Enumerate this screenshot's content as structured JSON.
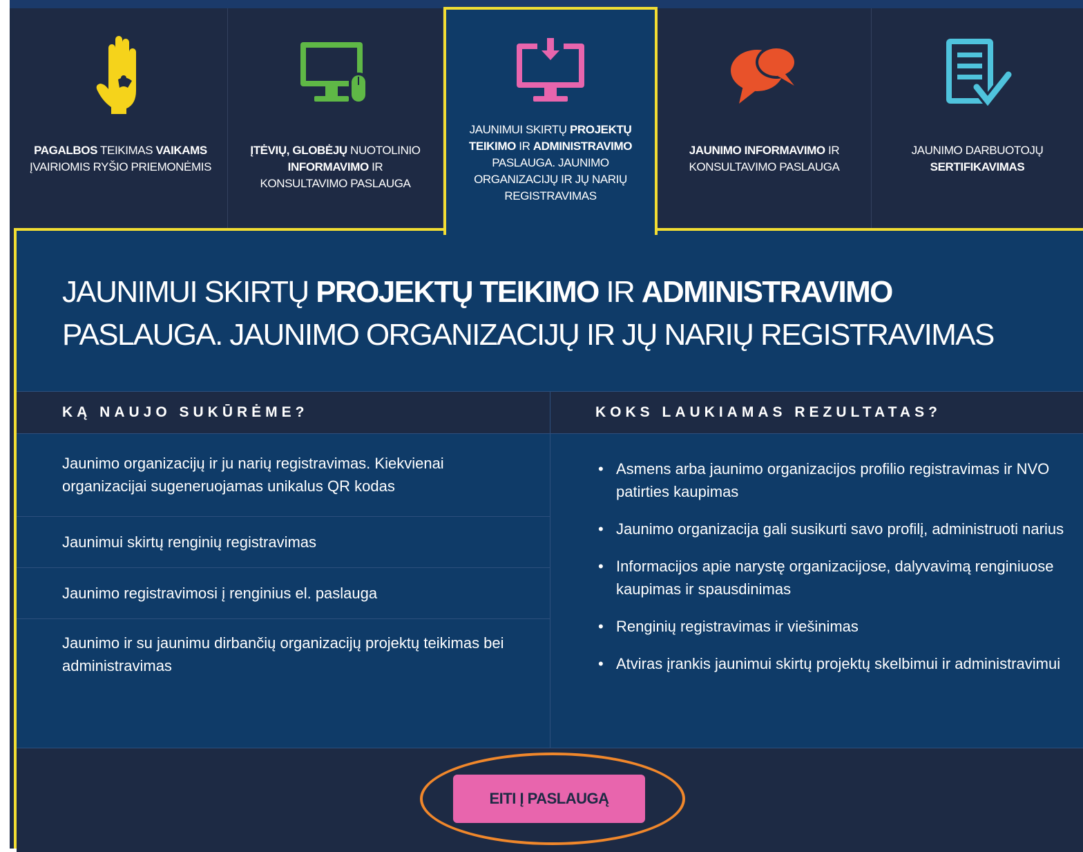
{
  "tabs": [
    {
      "parts": [
        [
          "PAGALBOS",
          true
        ],
        [
          " TEIKIMAS ",
          false
        ],
        [
          "VAIKAMS",
          true
        ],
        [
          "\nĮVAIRIOMIS RYŠIO PRIEMONĖMIS",
          false
        ]
      ],
      "icon": "hand-icon",
      "color": "#f5d31b"
    },
    {
      "parts": [
        [
          "ĮTĖVIŲ, GLOBĖJŲ",
          true
        ],
        [
          " NUOTOLINIO\n",
          false
        ],
        [
          "INFORMAVIMO",
          true
        ],
        [
          " IR\nKONSULTAVIMO PASLAUGA",
          false
        ]
      ],
      "icon": "computer-icon",
      "color": "#5fb846"
    },
    {
      "parts": [
        [
          "JAUNIMUI SKIRTŲ ",
          false
        ],
        [
          "PROJEKTŲ\nTEIKIMO",
          true
        ],
        [
          " IR ",
          false
        ],
        [
          "ADMINISTRAVIMO",
          true
        ],
        [
          "\nPASLAUGA. JAUNIMO\nORGANIZACIJŲ IR JŲ NARIŲ\nREGISTRAVIMAS",
          false
        ]
      ],
      "icon": "download-monitor-icon",
      "color": "#e865ad",
      "active": true
    },
    {
      "parts": [
        [
          "JAUNIMO INFORMAVIMO",
          true
        ],
        [
          " IR\nKONSULTAVIMO PASLAUGA",
          false
        ]
      ],
      "icon": "chat-bubbles-icon",
      "color": "#e8522a"
    },
    {
      "parts": [
        [
          "JAUNIMO DARBUOTOJŲ\n",
          false
        ],
        [
          "SERTIFIKAVIMAS",
          true
        ]
      ],
      "icon": "document-check-icon",
      "color": "#4fc3dd"
    }
  ],
  "headline_parts": [
    [
      "JAUNIMUI SKIRTŲ ",
      false
    ],
    [
      "PROJEKTŲ TEIKIMO",
      true
    ],
    [
      " IR ",
      false
    ],
    [
      "ADMINISTRAVIMO",
      true
    ],
    [
      " PASLAUGA. JAUNIMO ORGANIZACIJŲ IR JŲ NARIŲ REGISTRAVIMAS",
      false
    ]
  ],
  "left_heading": "KĄ NAUJO SUKŪRĖME?",
  "right_heading": "KOKS LAUKIAMAS REZULTATAS?",
  "left_items": [
    "Jaunimo organizacijų ir ju narių registravimas. Kiekvienai organizacijai sugeneruojamas unikalus QR kodas",
    "Jaunimui skirtų renginių registravimas",
    "Jaunimo registravimosi į renginius el. paslauga",
    "Jaunimo ir su jaunimu dirbančių organizacijų projektų teikimas bei administravimas"
  ],
  "right_items": [
    "Asmens arba jaunimo organizacijos profilio registravimas ir NVO patirties kaupimas",
    "Jaunimo organizacija gali susikurti savo profilį, administruoti narius",
    "Informacijos apie narystę organizacijose, dalyvavimą renginiuose kaupimas ir spausdinimas",
    "Renginių registravimas ir viešinimas",
    "Atviras įrankis jaunimui skirtų projektų skelbimui ir administravimui"
  ],
  "button_label": "EITI Į PASLAUGĄ",
  "colors": {
    "accent_border": "#f2dd33",
    "button": "#e865ad",
    "highlight_ellipse": "#f0872b",
    "panel": "#0f3b68",
    "dark": "#1d2a44"
  }
}
